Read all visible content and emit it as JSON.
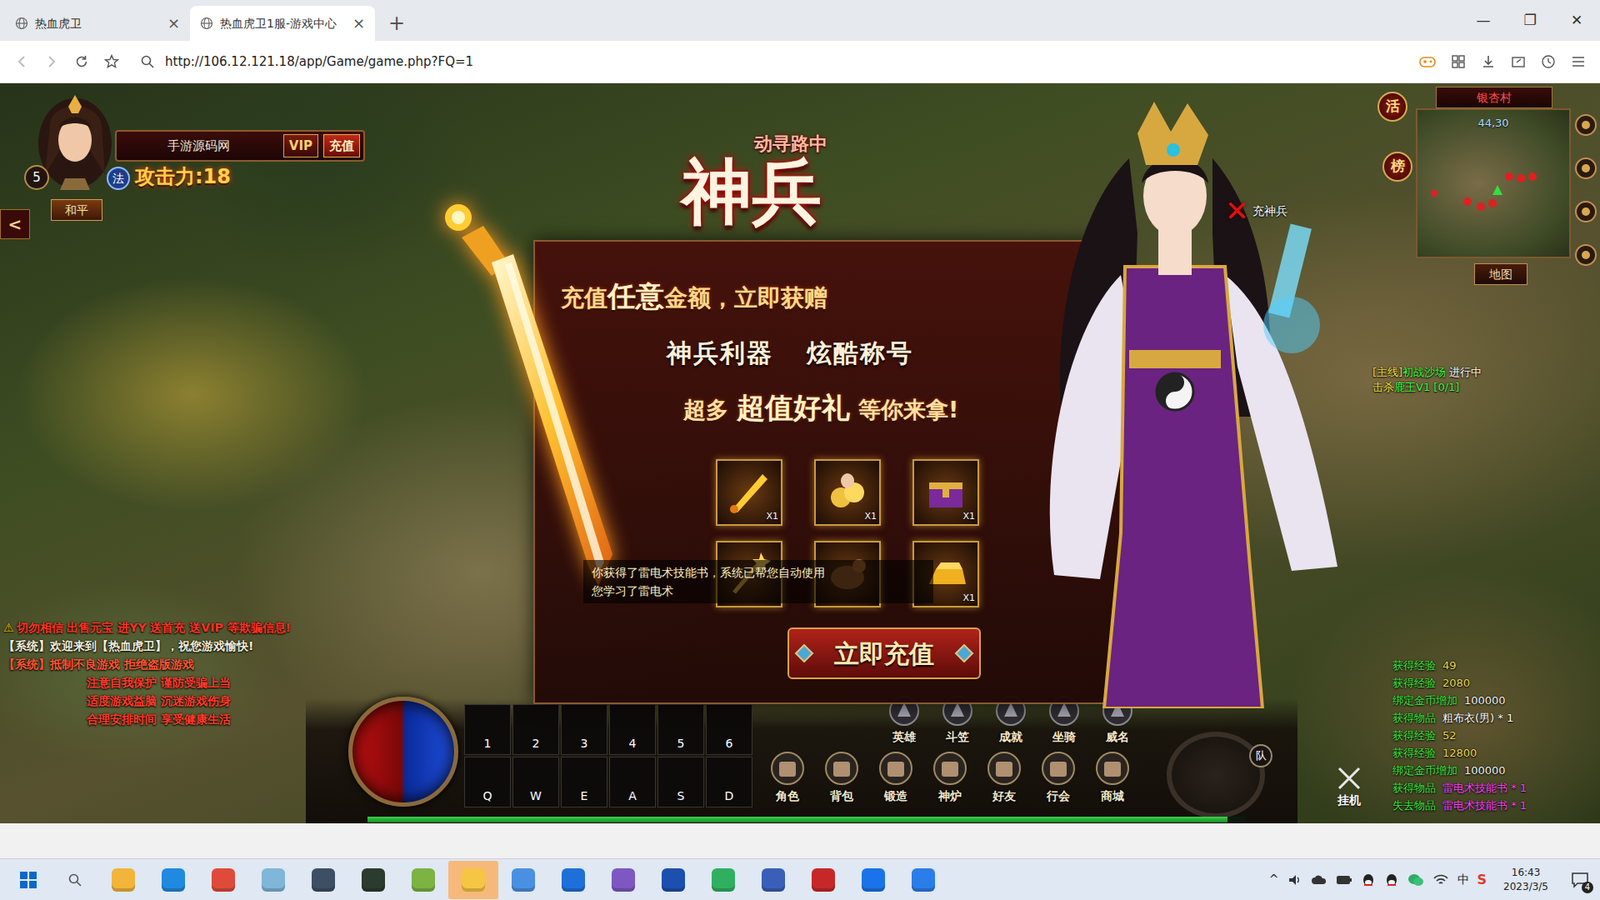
{
  "browser": {
    "tabs": [
      {
        "label": "热血虎卫",
        "selected": false,
        "close": "×"
      },
      {
        "label": "热血虎卫1服-游戏中心",
        "selected": true,
        "close": "×"
      }
    ],
    "new_tab": "+",
    "window_buttons": [
      "—",
      "❐",
      "✕"
    ],
    "url": "http://106.12.121.18/app/Game/game.php?FQ=1"
  },
  "game": {
    "player": {
      "name": "手游源码网",
      "vip": "VIP",
      "recharge": "充值",
      "level": "5",
      "job": "法",
      "attack": "攻击力:18",
      "mode": "和平"
    },
    "back": "<",
    "popup": {
      "pathing": "动寻路中",
      "title": "神兵",
      "close": "✕",
      "close_label": "充神兵",
      "line1": [
        {
          "text": "充值",
          "kind": "normal"
        },
        {
          "text": "任意",
          "kind": "big"
        },
        {
          "text": "金额，立即获赠",
          "kind": "normal"
        }
      ],
      "line2": [
        "神兵利器",
        "炫酷称号"
      ],
      "line3": [
        {
          "text": "超多",
          "kind": "normal"
        },
        {
          "text": "超值好礼",
          "kind": "big"
        },
        {
          "text": "等你来拿!",
          "kind": "normal"
        }
      ],
      "items": [
        {
          "count": "X1"
        },
        {
          "count": "X1"
        },
        {
          "count": "X1"
        },
        {},
        {},
        {
          "count": "X1"
        }
      ],
      "button": "立即充值"
    },
    "toast": [
      "你获得了雷电术技能书，系统已帮您自动使用",
      "您学习了雷电术"
    ],
    "minimap": {
      "place": "银杏村",
      "coords": "44,30",
      "activity": "活",
      "ranking": "榜",
      "map": "地图"
    },
    "quest": {
      "tag": "[主线]",
      "name": "初战沙场",
      "status": "进行中",
      "task": "击杀",
      "target": "鹿王V1",
      "progress": "[0/1]"
    },
    "chat": [
      {
        "icon": "⚠",
        "text": "切勿相信 出售元宝 进YY 送首充 送VIP 等欺骗信息!",
        "kind": "warning",
        "color": "#ff3322"
      },
      {
        "text": "【系统】欢迎来到【热血虎卫】，祝您游戏愉快!",
        "kind": "system",
        "color": "#f4ecd8"
      },
      {
        "text": "【系统】抵制不良游戏 拒绝盗版游戏",
        "kind": "system",
        "color": "#ff5533"
      },
      {
        "text": "注意自我保护 谨防受骗上当",
        "kind": "notice",
        "color": "#ff3a2a"
      },
      {
        "text": "适度游戏益脑 沉迷游戏伤身",
        "kind": "notice",
        "color": "#ff3a2a"
      },
      {
        "text": "合理安排时间 享受健康生活",
        "kind": "notice",
        "color": "#ff3a2a"
      }
    ],
    "skills": {
      "numbers": [
        "1",
        "2",
        "3",
        "4",
        "5",
        "6"
      ],
      "letters": [
        "Q",
        "W",
        "E",
        "A",
        "S",
        "D"
      ]
    },
    "menu_top": [
      "英雄",
      "斗笠",
      "成就",
      "坐骑",
      "威名"
    ],
    "menu_bottom": [
      "角色",
      "背包",
      "锻造",
      "神炉",
      "好友",
      "行会",
      "商城"
    ],
    "team": "队",
    "auto": "挂机",
    "exp_level": 0.98,
    "log": [
      {
        "label": "获得经验",
        "value": "49",
        "color": "#e8d44d"
      },
      {
        "label": "获得经验",
        "value": "2080",
        "color": "#e8d44d"
      },
      {
        "label": "绑定金币增加",
        "value": "100000",
        "color": "#f0f0f0"
      },
      {
        "label": "获得物品",
        "value": "粗布衣(男) * 1",
        "color": "#ffffff"
      },
      {
        "label": "获得经验",
        "value": "52",
        "color": "#e8d44d"
      },
      {
        "label": "获得经验",
        "value": "12800",
        "color": "#e8d44d"
      },
      {
        "label": "绑定金币增加",
        "value": "100000",
        "color": "#f0f0f0"
      },
      {
        "label": "获得物品",
        "value": "雷电术技能书 * 1",
        "color": "#ff40ff"
      },
      {
        "label": "失去物品",
        "value": "雷电术技能书 * 1",
        "color": "#ff40ff"
      }
    ]
  },
  "taskbar": {
    "apps": [
      {
        "color": "#f2b53a",
        "selected": false
      },
      {
        "color": "#1f8ae0",
        "selected": false
      },
      {
        "color": "#e04a3a",
        "selected": false
      },
      {
        "color": "#7fb6d9",
        "selected": false
      },
      {
        "color": "#3d4f63",
        "selected": false
      },
      {
        "color": "#2b3b2f",
        "selected": false
      },
      {
        "color": "#7cb342",
        "selected": false
      },
      {
        "color": "#f6c544",
        "selected": true
      },
      {
        "color": "#4a90e2",
        "selected": false
      },
      {
        "color": "#1e6fd9",
        "selected": false
      },
      {
        "color": "#7e57c2",
        "selected": false
      },
      {
        "color": "#1d4fb0",
        "selected": false
      },
      {
        "color": "#2fb061",
        "selected": false
      },
      {
        "color": "#3a5fb8",
        "selected": false
      },
      {
        "color": "#c62828",
        "selected": false
      },
      {
        "color": "#1a73e8",
        "selected": false
      },
      {
        "color": "#2b7de9",
        "selected": false
      }
    ],
    "tray_expand": "^",
    "ime": "中",
    "sogou": "S",
    "time": "16:43",
    "date": "2023/3/5",
    "notifications": "4"
  }
}
